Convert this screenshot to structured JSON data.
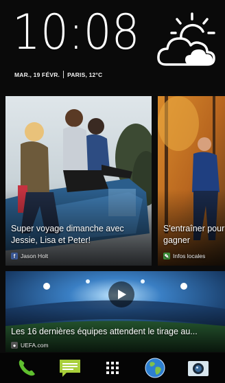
{
  "clock": {
    "time": "10:08",
    "date": "MAR., 19 FÉVR.",
    "location_temp": "PARIS, 12°C",
    "weather_icon": "partly-cloudy-icon"
  },
  "tiles": [
    {
      "caption": "Super voyage dimanche avec Jessie, Lisa et Peter!",
      "source": "Jason Holt",
      "source_icon": "facebook-icon",
      "source_color": "#3b5998"
    },
    {
      "caption": "S'entraîner pour gagner",
      "source": "Infos locales",
      "source_icon": "news-icon",
      "source_color": "#3d8f3a"
    },
    {
      "caption": "Les 16 dernières équipes attendent le tirage au...",
      "source": "UEFA.com",
      "source_icon": "person-icon",
      "source_color": "#666666"
    }
  ],
  "dock": [
    {
      "name": "phone-icon",
      "color": "#5fbf2f"
    },
    {
      "name": "messages-icon",
      "color": "#a8cf3a"
    },
    {
      "name": "apps-grid-icon",
      "color": "#ffffff"
    },
    {
      "name": "browser-globe-icon",
      "color": "#2d7fd0"
    },
    {
      "name": "camera-icon",
      "color": "#d8e6ee"
    }
  ]
}
